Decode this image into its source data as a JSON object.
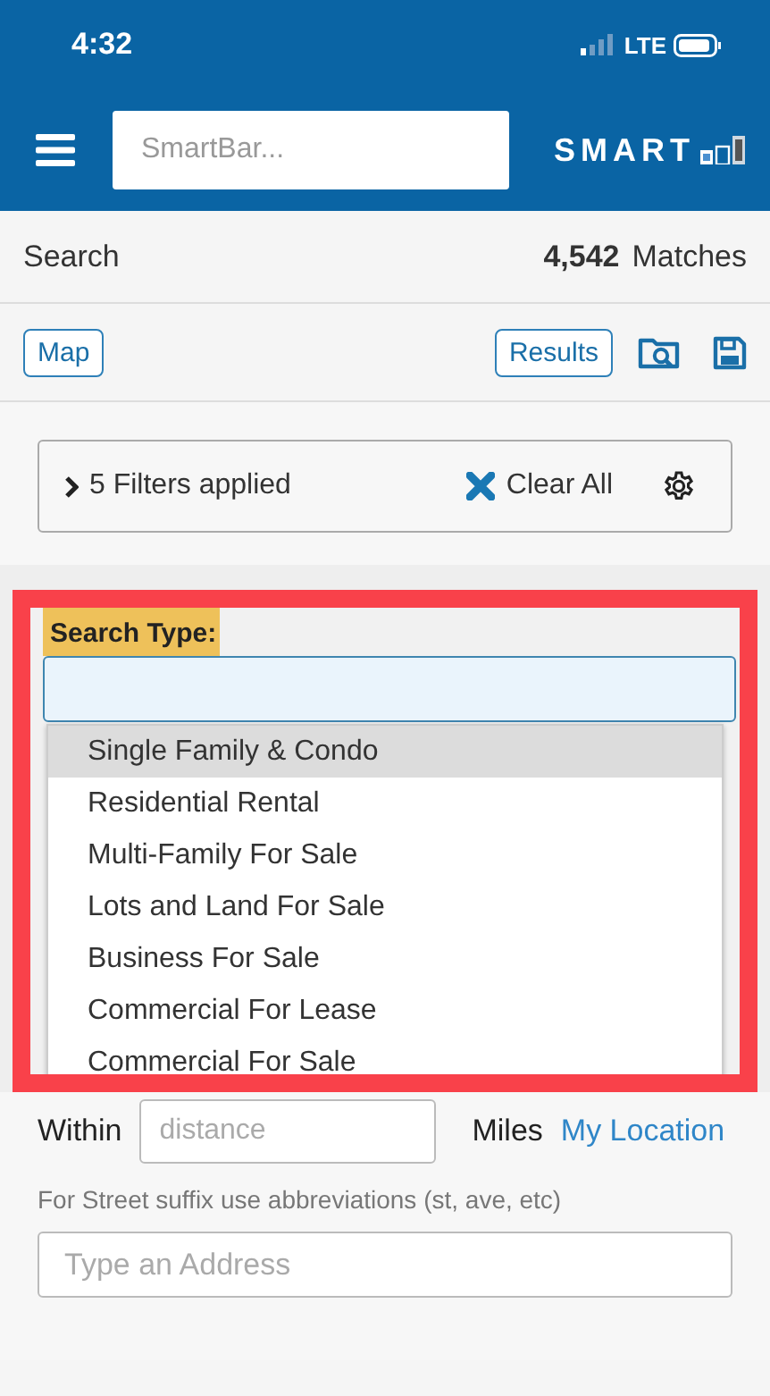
{
  "status_bar": {
    "time": "4:32",
    "network": "LTE"
  },
  "header": {
    "search_placeholder": "SmartBar...",
    "logo": "SMART"
  },
  "summary": {
    "title": "Search",
    "count": "4,542",
    "count_label": "Matches"
  },
  "toolbar": {
    "map_button": "Map",
    "results_button": "Results"
  },
  "filters": {
    "summary": "5 Filters applied",
    "clear": "Clear All"
  },
  "search_type": {
    "label": "Search Type:",
    "options": [
      {
        "label": "Single Family & Condo",
        "selected": true
      },
      {
        "label": "Residential Rental",
        "selected": false
      },
      {
        "label": "Multi-Family For Sale",
        "selected": false
      },
      {
        "label": "Lots and Land For Sale",
        "selected": false
      },
      {
        "label": "Business For Sale",
        "selected": false
      },
      {
        "label": "Commercial For Lease",
        "selected": false
      },
      {
        "label": "Commercial For Sale",
        "selected": false
      }
    ]
  },
  "location": {
    "within": "Within",
    "placeholder": "distance",
    "unit": "Miles",
    "link": "My Location"
  },
  "address": {
    "hint": "For Street suffix use abbreviations (st, ave, etc)",
    "placeholder": "Type an Address"
  }
}
